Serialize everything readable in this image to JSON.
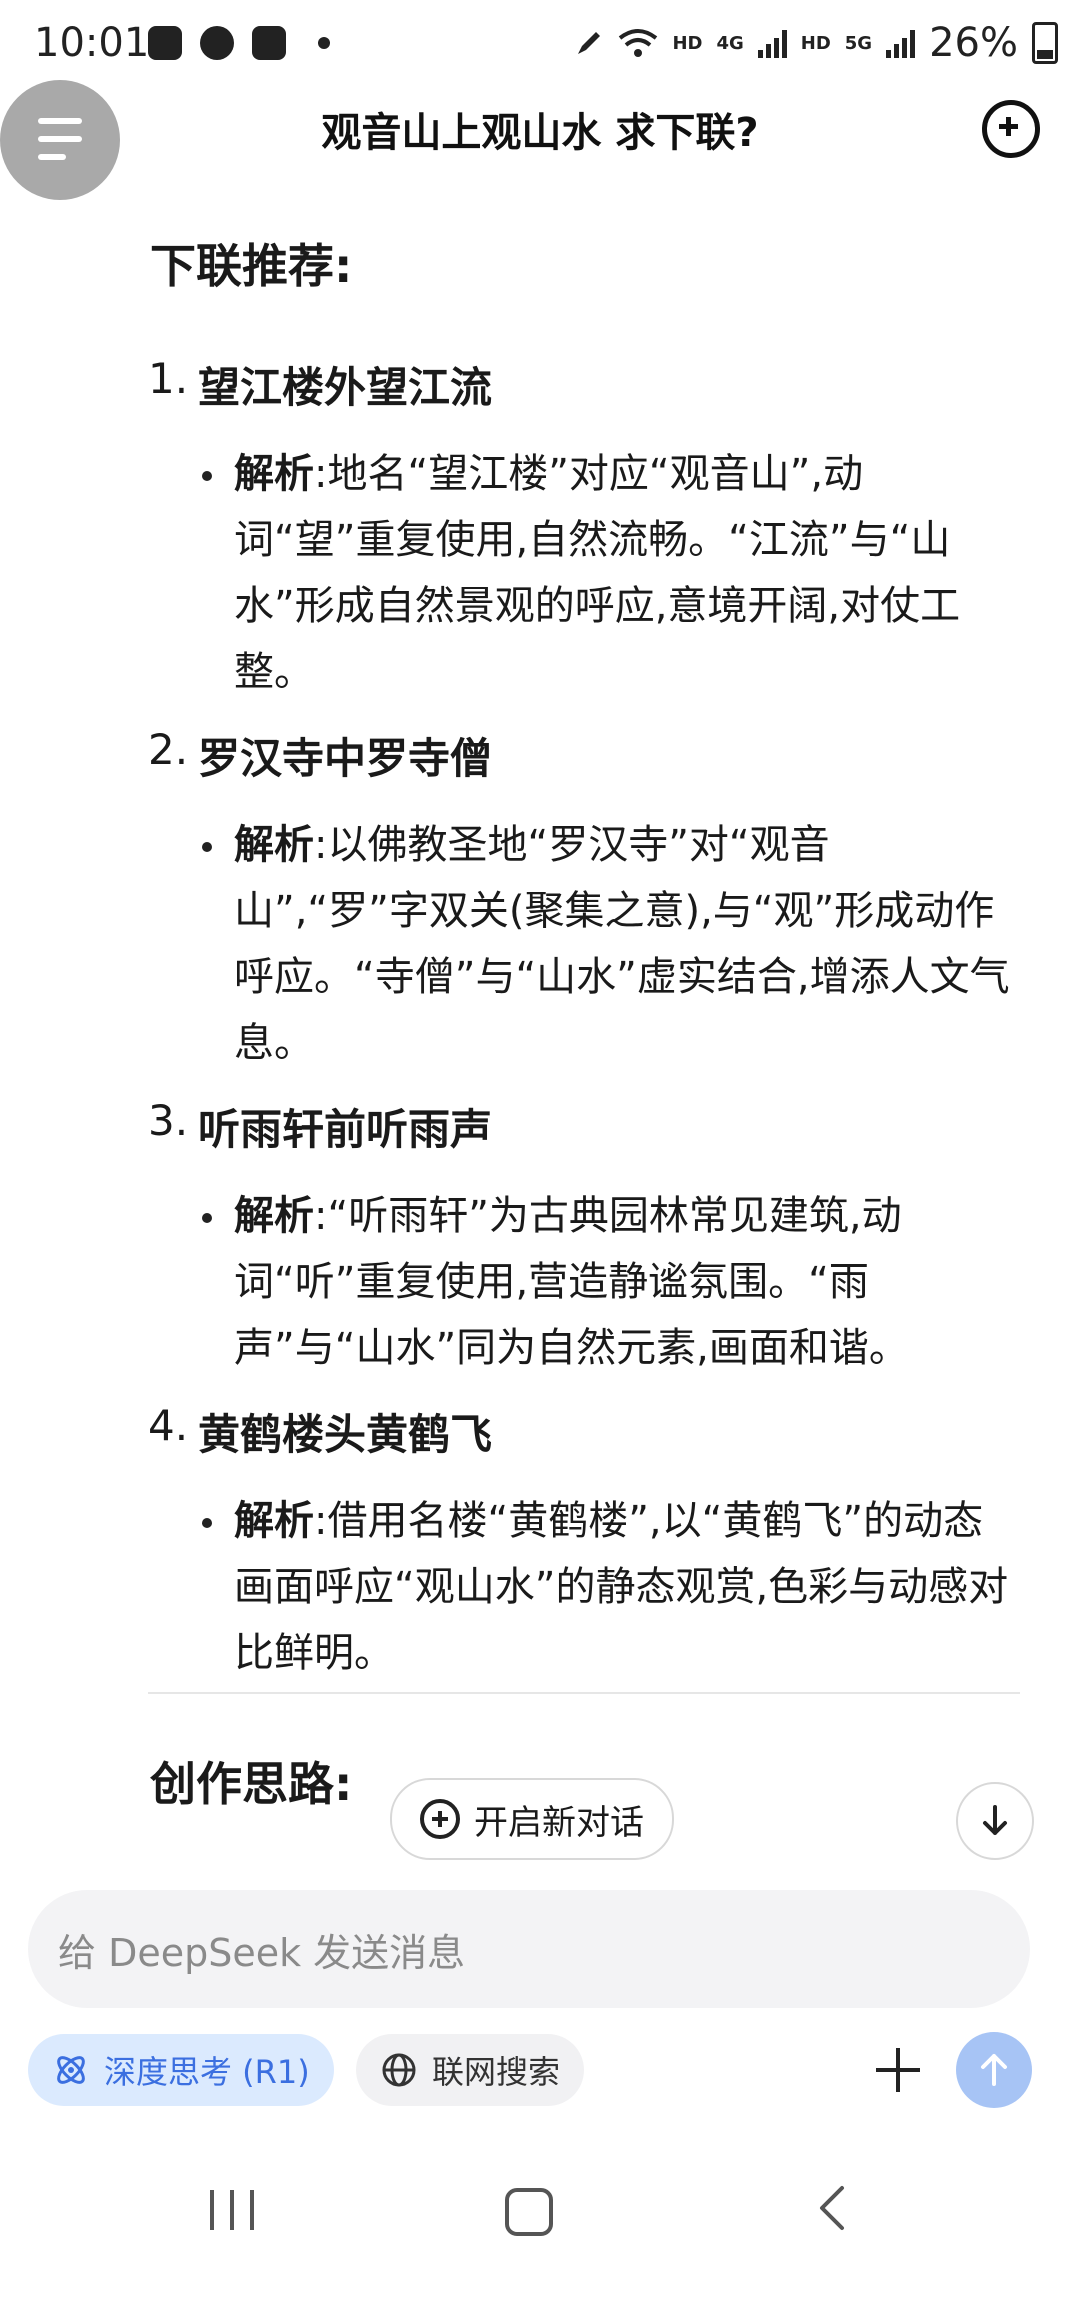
{
  "status_bar": {
    "time": "10:01",
    "net1": "HD",
    "net1_gen": "4G",
    "net2": "HD",
    "net2_gen": "5G",
    "battery": "26%"
  },
  "header": {
    "title": "观音山上观山水  求下联?"
  },
  "content": {
    "heading": "下联推荐:",
    "items": [
      {
        "num": "1.",
        "title": "望江楼外望江流",
        "label": "解析",
        "text": ":地名“望江楼”对应“观音山”,动词“望”重复使用,自然流畅。“江流”与“山水”形成自然景观的呼应,意境开阔,对仗工整。"
      },
      {
        "num": "2.",
        "title": "罗汉寺中罗寺僧",
        "label": "解析",
        "text": ":以佛教圣地“罗汉寺”对“观音山”,“罗”字双关(聚集之意),与“观”形成动作呼应。“寺僧”与“山水”虚实结合,增添人文气息。"
      },
      {
        "num": "3.",
        "title": "听雨轩前听雨声",
        "label": "解析",
        "text": ":“听雨轩”为古典园林常见建筑,动词“听”重复使用,营造静谧氛围。“雨声”与“山水”同为自然元素,画面和谐。"
      },
      {
        "num": "4.",
        "title": "黄鹤楼头黄鹤飞",
        "label": "解析",
        "text": ":借用名楼“黄鹤楼”,以“黄鹤飞”的动态画面呼应“观山水”的静态观赏,色彩与动感对比鲜明。"
      }
    ],
    "heading2": "创作思路:"
  },
  "floating": {
    "new_chat_label": "开启新对话"
  },
  "composer": {
    "placeholder": "给 DeepSeek 发送消息",
    "deep_think_label": "深度思考 (R1)",
    "web_search_label": "联网搜索"
  },
  "colors": {
    "accent": "#3b6fe0",
    "chip_bg": "#dbeafe",
    "send_bg": "#a7c4f5"
  }
}
